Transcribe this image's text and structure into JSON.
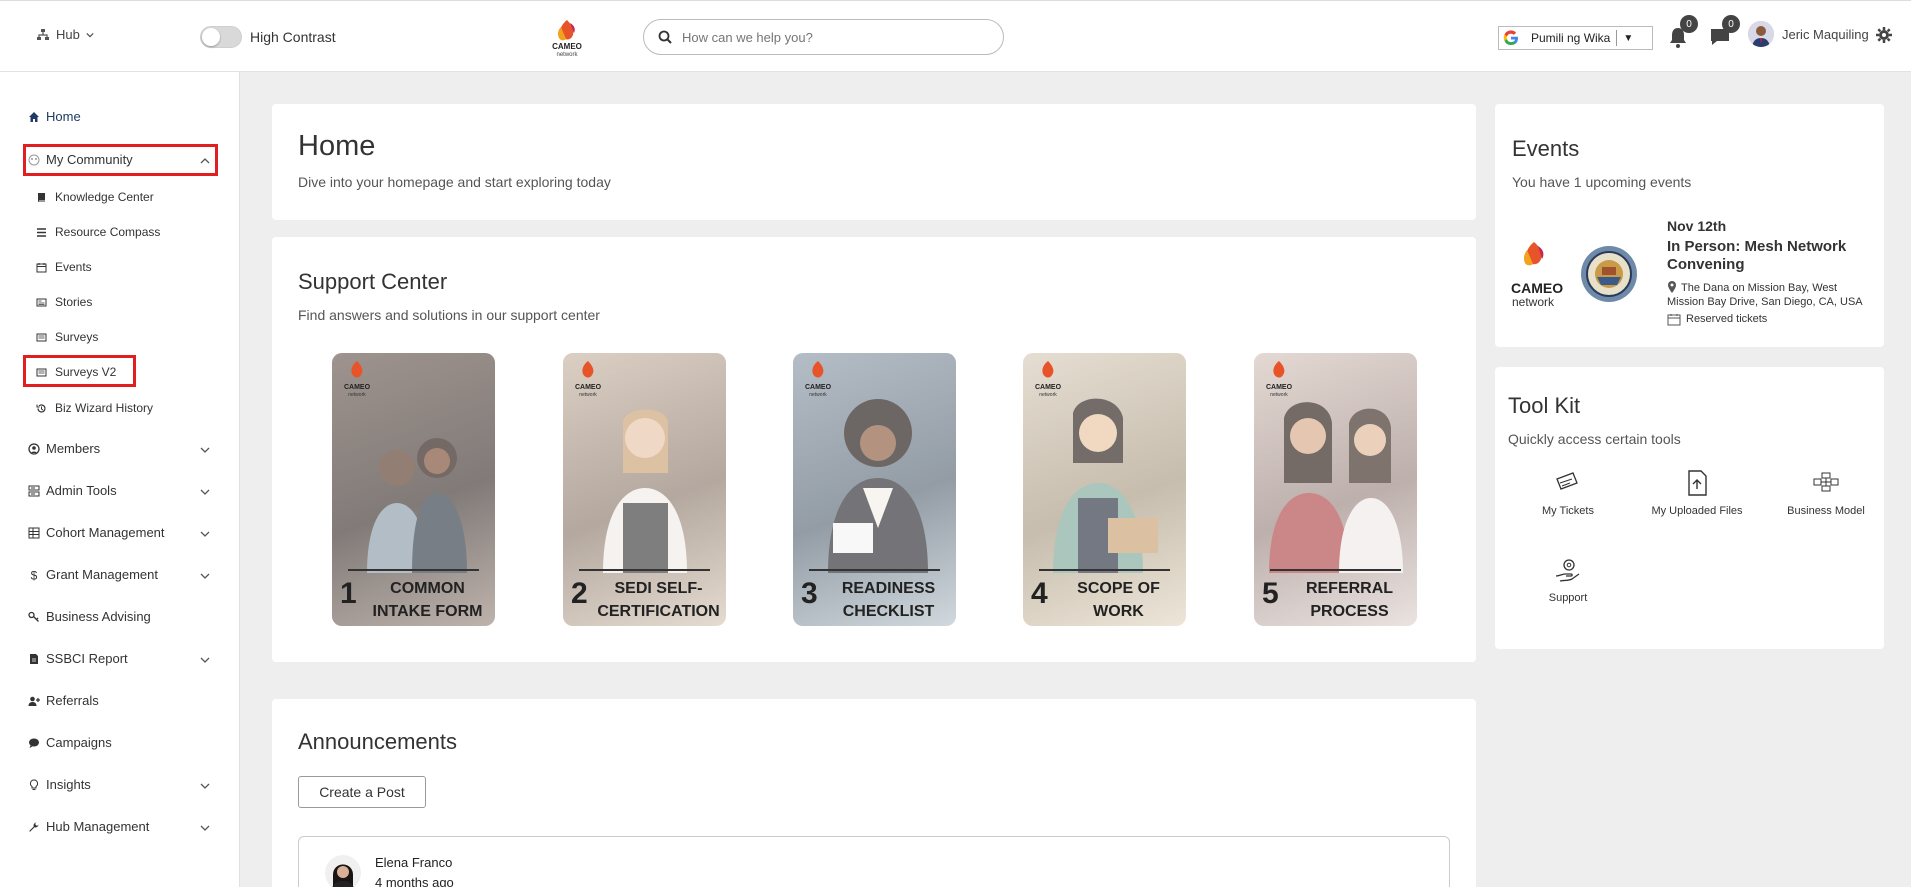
{
  "topbar": {
    "hub_label": "Hub",
    "high_contrast_label": "High Contrast",
    "search_placeholder": "How can we help you?",
    "translate_label": "Pumili ng Wika",
    "translate_arrow": "▼",
    "notifications_count": "0",
    "messages_count": "0",
    "user_name": "Jeric Maquiling"
  },
  "sidebar": {
    "home": "Home",
    "my_community": "My Community",
    "sub_items": [
      "Knowledge Center",
      "Resource Compass",
      "Events",
      "Stories",
      "Surveys",
      "Surveys V2",
      "Biz Wizard History"
    ],
    "items": [
      "Members",
      "Admin Tools",
      "Cohort Management",
      "Grant Management",
      "Business Advising",
      "SSBCI Report",
      "Referrals",
      "Campaigns",
      "Insights",
      "Hub Management"
    ]
  },
  "home_card": {
    "title": "Home",
    "subtitle": "Dive into your homepage and start exploring today"
  },
  "support": {
    "title": "Support Center",
    "subtitle": "Find answers and solutions in our support center",
    "tiles": [
      {
        "num": "1",
        "label": "COMMON INTAKE FORM"
      },
      {
        "num": "2",
        "label": "SEDI SELF-CERTIFICATION"
      },
      {
        "num": "3",
        "label": "READINESS CHECKLIST"
      },
      {
        "num": "4",
        "label": "SCOPE OF WORK"
      },
      {
        "num": "5",
        "label": "REFERRAL PROCESS"
      }
    ]
  },
  "announcements": {
    "title": "Announcements",
    "create_label": "Create a Post",
    "post_author": "Elena Franco",
    "post_time": "4 months ago"
  },
  "events": {
    "title": "Events",
    "subtitle": "You have 1 upcoming events",
    "logo_text": "CAMEO",
    "logo_sub": "network",
    "date": "Nov 12th",
    "event_title": "In Person: Mesh Network Convening",
    "location": "The Dana on Mission Bay, West Mission Bay Drive, San Diego, CA, USA",
    "tickets": "Reserved tickets"
  },
  "toolkit": {
    "title": "Tool Kit",
    "subtitle": "Quickly access certain tools",
    "tools": [
      "My Tickets",
      "My Uploaded Files",
      "Business Model",
      "Support"
    ]
  },
  "colors": {
    "highlight": "#e02020",
    "nav_active": "#1f3b63"
  }
}
